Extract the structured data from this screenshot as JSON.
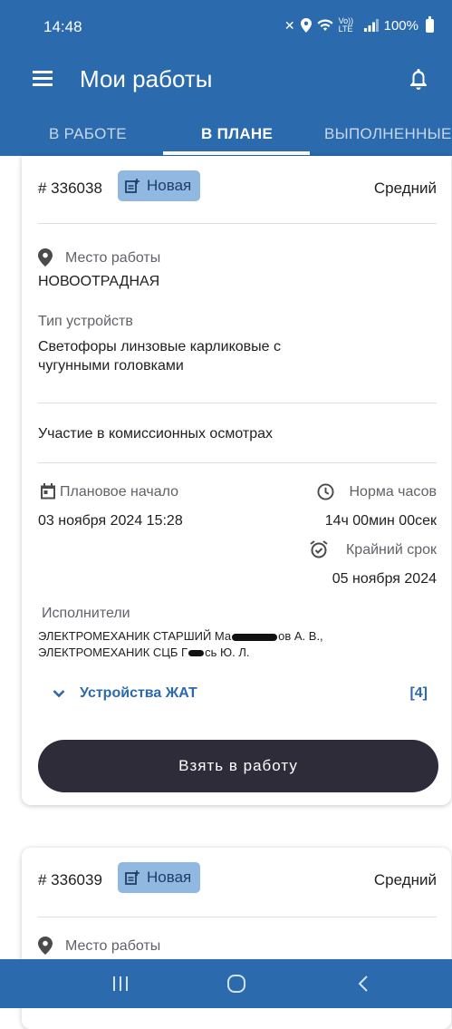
{
  "status_bar": {
    "time": "14:48",
    "signal_text": "Vo)) LTE",
    "battery": "100%"
  },
  "app_bar": {
    "title": "Мои работы",
    "menu_icon": "hamburger-menu-icon",
    "notification_icon": "bell-icon"
  },
  "tabs": [
    {
      "label": "В РАБОТЕ",
      "active": false
    },
    {
      "label": "В ПЛАНЕ",
      "active": true
    },
    {
      "label": "ВЫПОЛНЕННЫЕ",
      "active": false
    }
  ],
  "cards": [
    {
      "number": "# 336038",
      "status": "Новая",
      "priority": "Средний",
      "location_label": "Место работы",
      "location": "НОВООТРАДНАЯ",
      "device_type_label": "Тип устройств",
      "device_type_line1": "Светофоры линзовые карликовые с",
      "device_type_line2": "чугунными головками",
      "task": "Участие в комиссионных осмотрах",
      "planned_start_label": "Плановое начало",
      "planned_start": "03 ноября 2024  15:28",
      "hours_norm_label": "Норма часов",
      "hours_norm": "14ч 00мин 00сек",
      "deadline_label": "Крайний срок",
      "deadline": "05 ноября 2024",
      "executors_label": "Исполнители",
      "executor1_prefix": "ЭЛЕКТРОМЕХАНИК СТАРШИЙ Ма",
      "executor1_suffix": "ов А. В.,",
      "executor2_prefix": "ЭЛЕКТРОМЕХАНИК СЦБ Г",
      "executor2_suffix": "сь Ю. Л.",
      "devices_link": "Устройства ЖАТ",
      "devices_count": "[4]",
      "take_button": "Взять в работу"
    },
    {
      "number": "# 336039",
      "status": "Новая",
      "priority": "Средний",
      "location_label": "Место работы"
    }
  ],
  "colors": {
    "primary": "#2a6aad",
    "badge": "#90b8e0",
    "button": "#2f2c3a"
  }
}
